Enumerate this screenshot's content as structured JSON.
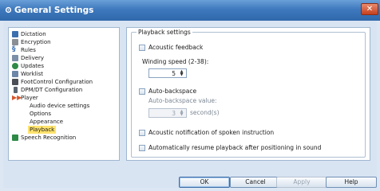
{
  "window": {
    "title": "General Settings",
    "close_glyph": "✕"
  },
  "tree": {
    "items": [
      {
        "label": "Dictation",
        "icon": "dictation-icon",
        "color": "#3a6fb0"
      },
      {
        "label": "Encryption",
        "icon": "lock-icon",
        "color": "#8a8f96"
      },
      {
        "label": "Rules",
        "icon": "paragraph-icon",
        "glyph": "§",
        "color": "#3a6fb0"
      },
      {
        "label": "Delivery",
        "icon": "mail-icon",
        "color": "#7b8fa8"
      },
      {
        "label": "Updates",
        "icon": "globe-icon",
        "color": "#2f8a47"
      },
      {
        "label": "Worklist",
        "icon": "list-icon",
        "color": "#6b86a8"
      },
      {
        "label": "FootControl Configuration",
        "icon": "footcontrol-icon",
        "color": "#4a4f57"
      },
      {
        "label": "DPM/DT Configuration",
        "icon": "recorder-icon",
        "color": "#5a6470"
      },
      {
        "label": "Player",
        "icon": "player-icon",
        "color": "#d4562b"
      },
      {
        "label": "Audio device settings",
        "child": true
      },
      {
        "label": "Options",
        "child": true
      },
      {
        "label": "Appearance",
        "child": true
      },
      {
        "label": "Playback",
        "child": true,
        "selected": true
      },
      {
        "label": "Speech Recognition",
        "icon": "speech-icon",
        "color": "#2f8a47"
      }
    ]
  },
  "playback": {
    "group_title": "Playback settings",
    "acoustic_feedback": {
      "label": "Acoustic feedback",
      "checked": false
    },
    "winding_speed": {
      "label": "Winding speed (2-38):",
      "value": "5"
    },
    "auto_backspace": {
      "label": "Auto-backspace",
      "checked": false
    },
    "auto_backspace_value": {
      "label": "Auto-backspace value:",
      "value": "3",
      "unit": "second(s)"
    },
    "acoustic_notification": {
      "label": "Acoustic notification of spoken instruction",
      "checked": false
    },
    "auto_resume": {
      "label": "Automatically resume playback after positioning in sound",
      "checked": false
    }
  },
  "buttons": {
    "ok": "OK",
    "cancel": "Cancel",
    "apply": "Apply",
    "help": "Help"
  },
  "colors": {
    "title_bar": "#3f79bd",
    "selection": "#ffe36e",
    "close": "#c6401e"
  }
}
